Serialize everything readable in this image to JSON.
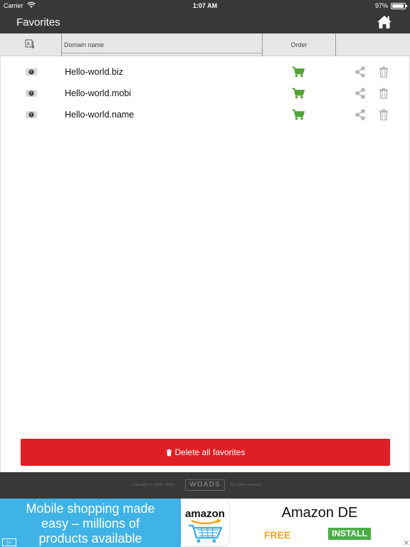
{
  "status_bar": {
    "carrier": "Carrier",
    "time": "1:07 AM",
    "battery_percent": "97%",
    "battery_level": 0.97
  },
  "nav": {
    "title": "Favorites",
    "home_icon": "home-icon"
  },
  "table": {
    "sort_icon": "sort-alpha-icon",
    "columns": {
      "domain": "Domain name",
      "order": "Order"
    },
    "rows": [
      {
        "domain": "Hello-world.biz"
      },
      {
        "domain": "Hello-world.mobi"
      },
      {
        "domain": "Hello-world.name"
      }
    ],
    "row_icons": {
      "globe": "globe-icon",
      "cart": "cart-icon",
      "share": "share-icon",
      "trash": "trash-icon"
    }
  },
  "delete_button": {
    "label": "Delete all favorites"
  },
  "footer": {
    "copyright": "Copyright © 2010 - 2016",
    "logo": "WOADS",
    "rights": "All rights reserved"
  },
  "ad": {
    "headline": [
      "Mobile shopping made",
      "easy – millions of",
      "products available"
    ],
    "logo_word": "amazon",
    "title": "Amazon DE",
    "price": "FREE",
    "install": "INSTALL",
    "adchoices": "▷"
  },
  "colors": {
    "bar": "#383838",
    "header": "#e7e7e7",
    "cart": "#52a33a",
    "action_gray": "#b5b5b5",
    "delete": "#de1f26",
    "ad_blue": "#3fb3e6",
    "ad_free": "#f7a51c",
    "ad_install": "#4aad45"
  }
}
